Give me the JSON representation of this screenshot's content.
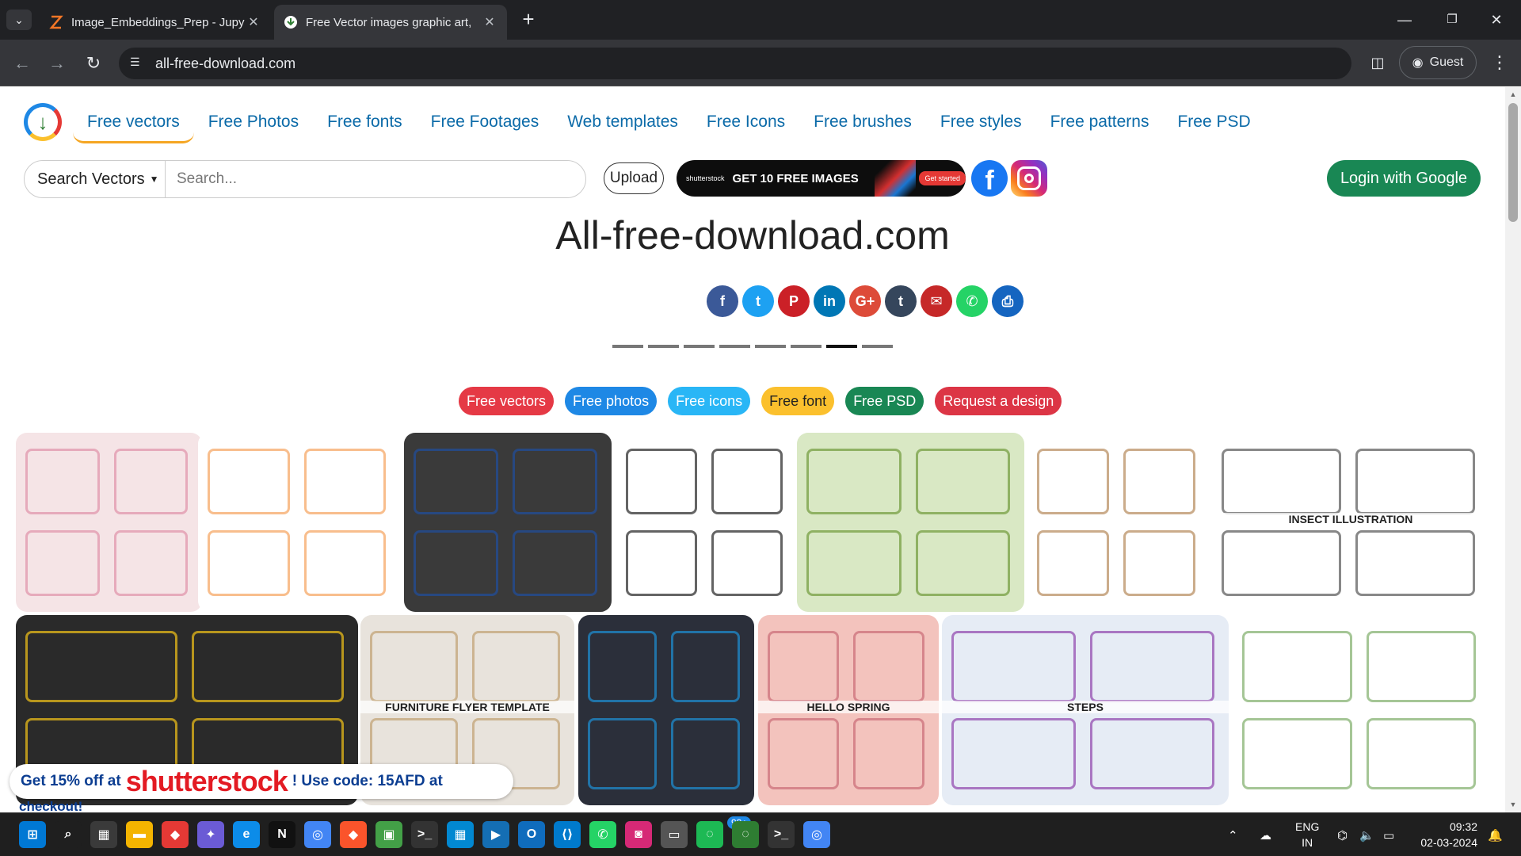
{
  "browser": {
    "tabs": [
      {
        "title": "Image_Embeddings_Prep - Jupy",
        "active": false
      },
      {
        "title": "Free Vector images graphic art,",
        "active": true
      }
    ],
    "url": "all-free-download.com",
    "profile_label": "Guest",
    "window_controls": [
      "minimize-icon",
      "restore-icon",
      "close-icon"
    ]
  },
  "site": {
    "nav": [
      "Free vectors",
      "Free Photos",
      "Free fonts",
      "Free Footages",
      "Web templates",
      "Free Icons",
      "Free brushes",
      "Free styles",
      "Free patterns",
      "Free PSD"
    ],
    "search": {
      "category": "Search Vectors",
      "placeholder": "Search..."
    },
    "upload_label": "Upload",
    "banner": {
      "brand": "shutterstock",
      "text": "GET 10 FREE IMAGES",
      "cta": "Get started"
    },
    "login_label": "Login with Google",
    "title": "All-free-download.com",
    "share_icons": [
      {
        "name": "facebook",
        "glyph": "f",
        "color": "#3b5998"
      },
      {
        "name": "twitter",
        "glyph": "t",
        "color": "#1da1f2"
      },
      {
        "name": "pinterest",
        "glyph": "P",
        "color": "#cb2027"
      },
      {
        "name": "linkedin",
        "glyph": "in",
        "color": "#0077b5"
      },
      {
        "name": "google-plus",
        "glyph": "G+",
        "color": "#dd4b39"
      },
      {
        "name": "tumblr",
        "glyph": "t",
        "color": "#35465c"
      },
      {
        "name": "email",
        "glyph": "✉",
        "color": "#c62828"
      },
      {
        "name": "whatsapp",
        "glyph": "✆",
        "color": "#25d366"
      },
      {
        "name": "print",
        "glyph": "⎙",
        "color": "#1565c0"
      }
    ],
    "carousel_active_index": 6,
    "carousel_count": 8,
    "pills": [
      {
        "label": "Free vectors",
        "color": "#e53945"
      },
      {
        "label": "Free photos",
        "color": "#1e88e5"
      },
      {
        "label": "Free icons",
        "color": "#29b6f6"
      },
      {
        "label": "Free font",
        "color": "#fbc02d"
      },
      {
        "label": "Free PSD",
        "color": "#198754"
      },
      {
        "label": "Request a design",
        "color": "#dc3545"
      }
    ],
    "thumbnails_row1": [
      {
        "name": "wedding-card",
        "bg": "#f5e4e6",
        "accent": "#e091a8"
      },
      {
        "name": "baby-items",
        "bg": "#ffffff",
        "accent": "#f5a25d"
      },
      {
        "name": "denim-banner",
        "bg": "#3a3a3a",
        "accent": "#1f4fa0"
      },
      {
        "name": "coffee-logos",
        "bg": "#ffffff",
        "accent": "#222222"
      },
      {
        "name": "leaf-flyer",
        "bg": "#d9e8c4",
        "accent": "#6f9a3a"
      },
      {
        "name": "box-template",
        "bg": "#ffffff",
        "accent": "#b5895a"
      },
      {
        "name": "insect-illustration",
        "bg": "#ffffff",
        "accent": "#555555",
        "caption": "INSECT ILLUSTRATION"
      }
    ],
    "thumbnails_row2": [
      {
        "name": "abstract-banners",
        "bg": "#2a2a2a",
        "accent": "#f5c518"
      },
      {
        "name": "furniture-flyer",
        "bg": "#e8e3dc",
        "accent": "#c0a070",
        "caption": "FURNITURE FLYER TEMPLATE"
      },
      {
        "name": "resume-template",
        "bg": "#2b2f3a",
        "accent": "#1e90d6"
      },
      {
        "name": "hello-spring",
        "bg": "#f3c3bd",
        "accent": "#c96b76",
        "caption": "HELLO SPRING"
      },
      {
        "name": "infographic-steps",
        "bg": "#e6ecf5",
        "accent": "#8e44ad",
        "caption": "STEPS"
      },
      {
        "name": "floral-frame",
        "bg": "#ffffff",
        "accent": "#7fae6a"
      }
    ],
    "promo": {
      "prefix": "Get 15% off at",
      "brand": "shutterstock",
      "suffix": "! Use code: 15AFD at",
      "tail": "checkout!"
    }
  },
  "taskbar": {
    "apps": [
      "windows-start",
      "search",
      "store",
      "file-explorer",
      "app-red",
      "copilot",
      "edge",
      "netflix",
      "chrome",
      "brave",
      "photos",
      "terminal",
      "app-blue",
      "prime-video",
      "outlook",
      "vscode",
      "whatsapp",
      "instagram",
      "app-gray",
      "spotify-green",
      "app-green",
      "powershell",
      "chrome-active"
    ],
    "whatsapp_badge": "99+",
    "lang_top": "ENG",
    "lang_bottom": "IN",
    "time": "09:32",
    "date": "02-03-2024"
  }
}
